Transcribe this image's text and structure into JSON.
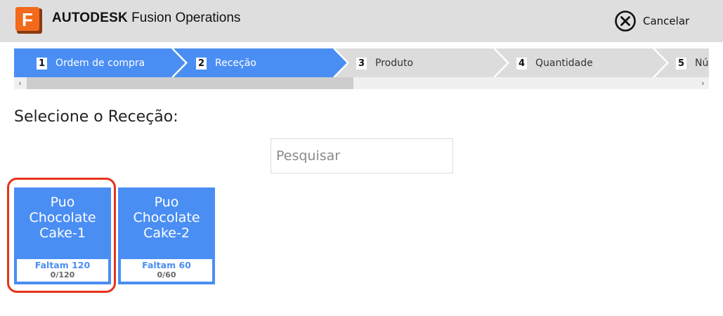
{
  "header": {
    "brand_bold": "AUTODESK",
    "brand_product": "Fusion Operations",
    "logo_letter": "F",
    "logo_icon": "autodesk-fusion-logo",
    "cancel_label": "Cancelar",
    "cancel_icon": "close-circle-icon"
  },
  "steps": [
    {
      "number": "1",
      "label": "Ordem de compra",
      "state": "active"
    },
    {
      "number": "2",
      "label": "Receção",
      "state": "active"
    },
    {
      "number": "3",
      "label": "Produto",
      "state": "inactive"
    },
    {
      "number": "4",
      "label": "Quantidade",
      "state": "inactive"
    },
    {
      "number": "5",
      "label": "Nú",
      "state": "inactive"
    }
  ],
  "scroll": {
    "left_arrow": "‹",
    "right_arrow": "›"
  },
  "main": {
    "title": "Selecione o Receção:",
    "search_placeholder": "Pesquisar"
  },
  "cards": [
    {
      "name_lines": [
        "Puo",
        "Chocolate",
        "Cake-1"
      ],
      "remaining": "Faltam 120",
      "progress": "0/120",
      "highlighted": true
    },
    {
      "name_lines": [
        "Puo",
        "Chocolate",
        "Cake-2"
      ],
      "remaining": "Faltam 60",
      "progress": "0/60",
      "highlighted": false
    }
  ],
  "colors": {
    "header_bg": "#dedede",
    "step_active": "#4a8ef4",
    "step_inactive": "#dcdcdc",
    "card_bg": "#4a8ef4",
    "logo_orange": "#f26a1b",
    "highlight": "#e8321b"
  }
}
